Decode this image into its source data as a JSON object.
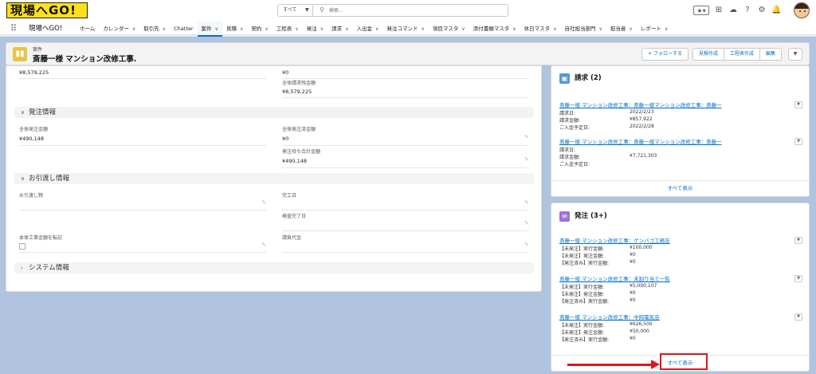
{
  "brand": {
    "logo_text": "現場へGO!",
    "logo_color": "#ffe11a"
  },
  "search": {
    "scope": "すべて",
    "placeholder": "検索..."
  },
  "nav": {
    "app_name": "現場へGO!",
    "items": [
      {
        "label": "ホーム",
        "chev": ""
      },
      {
        "label": "カレンダー",
        "chev": "∨"
      },
      {
        "label": "取引先",
        "chev": "∨"
      },
      {
        "label": "Chatter",
        "chev": ""
      },
      {
        "label": "案件",
        "chev": "∨"
      },
      {
        "label": "見積",
        "chev": "∨"
      },
      {
        "label": "契約",
        "chev": "∨"
      },
      {
        "label": "工程表",
        "chev": "∨"
      },
      {
        "label": "発注",
        "chev": "∨"
      },
      {
        "label": "請求",
        "chev": "∨"
      },
      {
        "label": "入出金",
        "chev": "∨"
      },
      {
        "label": "発注コマンド",
        "chev": "∨"
      },
      {
        "label": "項目マスタ",
        "chev": "∨"
      },
      {
        "label": "添付書類マスタ",
        "chev": "∨"
      },
      {
        "label": "休日マスタ",
        "chev": "∨"
      },
      {
        "label": "自社担当部門",
        "chev": "∨"
      },
      {
        "label": "担当者",
        "chev": "∨"
      },
      {
        "label": "レポート",
        "chev": "∨"
      }
    ],
    "active_index": 4
  },
  "record": {
    "object_label": "案件",
    "title": "斎藤一様 マンション改修工事.",
    "buttons": {
      "follow": "+ フォローする",
      "estimate": "見積作成",
      "schedule": "工程表作成",
      "edit": "編集",
      "menu": "▼"
    }
  },
  "detail": {
    "top": {
      "left_value": "¥8,579,225",
      "right_value": "¥0",
      "right2_label": "全体請求残金額",
      "right2_value": "¥8,579,225"
    },
    "order_section": {
      "title": "発注情報",
      "total_order_label": "全体発注金額",
      "total_order_value": "¥490,148",
      "ordered_label": "全体発注済金額",
      "ordered_value": "¥0",
      "pending_label": "発注待ち合計金額",
      "pending_value": "¥490,148"
    },
    "delivery_section": {
      "title": "お引渡し情報",
      "handover_label": "お引渡し物",
      "completion_label": "完工日",
      "inspection_label": "検査完了日",
      "transfer_label": "本体工事金額を転記",
      "contract_label": "請負代金"
    },
    "system_section": {
      "title": "システム情報"
    }
  },
  "billing_card": {
    "title": "請求 (2)",
    "icon_color": "#5a95d8",
    "records": [
      {
        "link": "斎藤一様 マンション改修工事：斎藤一様マンション改修工事：斎藤一",
        "fields": [
          {
            "k": "請求日:",
            "v": "2022/2/23"
          },
          {
            "k": "請求金額:",
            "v": "¥857,922"
          },
          {
            "k": "ご入金予定日:",
            "v": "2022/2/28"
          }
        ]
      },
      {
        "link": "斎藤一様 マンション改修工事：斎藤一様マンション改修工事：斎藤一",
        "fields": [
          {
            "k": "請求日:",
            "v": ""
          },
          {
            "k": "請求金額:",
            "v": "¥7,721,303"
          },
          {
            "k": "ご入金予定日:",
            "v": ""
          }
        ]
      }
    ],
    "footer": "すべて表示"
  },
  "order_card": {
    "title": "発注 (3+)",
    "icon_color": "#9b72d8",
    "records": [
      {
        "link": "斎藤一様 マンション改修工事：ゲンバゴ工務店",
        "fields": [
          {
            "k": "【未発注】実行金額:",
            "v": "¥100,000"
          },
          {
            "k": "【未発注】発注金額:",
            "v": "¥0"
          },
          {
            "k": "【発注済み】実行金額:",
            "v": "¥0"
          }
        ]
      },
      {
        "link": "斎藤一様 マンション改修工事：未割り当て一覧",
        "fields": [
          {
            "k": "【未発注】実行金額:",
            "v": "¥5,000,107"
          },
          {
            "k": "【未発注】発注金額:",
            "v": "¥0"
          },
          {
            "k": "【発注済み】実行金額:",
            "v": "¥0"
          }
        ]
      },
      {
        "link": "斎藤一様 マンション改修工事：中岡電気店",
        "fields": [
          {
            "k": "【未発注】実行金額:",
            "v": "¥626,500"
          },
          {
            "k": "【未発注】発注金額:",
            "v": "¥50,000"
          },
          {
            "k": "【発注済み】実行金額:",
            "v": "¥0"
          }
        ]
      }
    ],
    "footer": "すべて表示"
  },
  "annotation_color": "#e0161a"
}
